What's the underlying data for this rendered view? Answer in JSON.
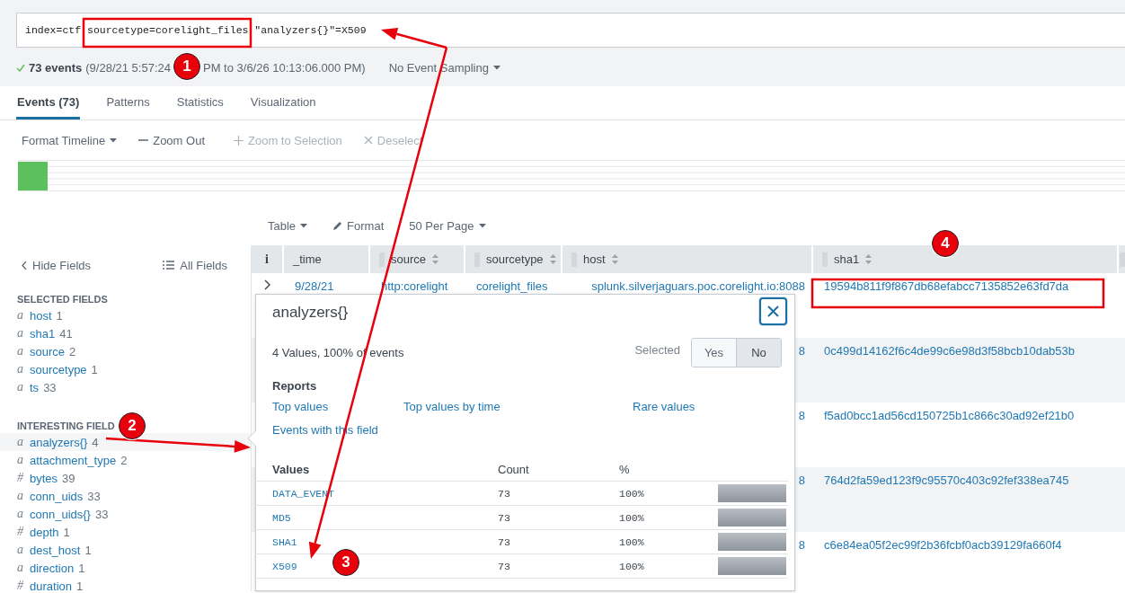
{
  "search": {
    "query": "index=ctf sourcetype=corelight_files \"analyzers{}\"=X509"
  },
  "status": {
    "count": "73 events",
    "range_start": "(9/28/21 5:57:24",
    "range_end": "PM to 3/6/26 10:13:06.000 PM)",
    "sampling": "No Event Sampling"
  },
  "tabs": [
    {
      "label": "Events (73)",
      "selected": true
    },
    {
      "label": "Patterns",
      "selected": false
    },
    {
      "label": "Statistics",
      "selected": false
    },
    {
      "label": "Visualization",
      "selected": false
    }
  ],
  "timeline_toolbar": [
    {
      "kind": "menu",
      "label": "Format Timeline",
      "disabled": false
    },
    {
      "kind": "minus",
      "label": "Zoom Out",
      "disabled": false
    },
    {
      "kind": "plus",
      "label": "Zoom to Selection",
      "disabled": true
    },
    {
      "kind": "cross",
      "label": "Deselect",
      "disabled": true
    }
  ],
  "results_toolbar": [
    {
      "kind": "menu",
      "label": "Table"
    },
    {
      "kind": "pencil",
      "label": "Format"
    },
    {
      "kind": "menu",
      "label": "50 Per Page"
    }
  ],
  "sidebar": {
    "hide_label": "Hide Fields",
    "all_label": "All Fields",
    "sections": [
      {
        "title": "SELECTED FIELDS",
        "fields": [
          {
            "type": "a",
            "name": "host",
            "count": "1",
            "selected": false
          },
          {
            "type": "a",
            "name": "sha1",
            "count": "41",
            "selected": false
          },
          {
            "type": "a",
            "name": "source",
            "count": "2",
            "selected": false
          },
          {
            "type": "a",
            "name": "sourcetype",
            "count": "1",
            "selected": false
          },
          {
            "type": "a",
            "name": "ts",
            "count": "33",
            "selected": false
          }
        ]
      },
      {
        "title": "INTERESTING FIELD",
        "fields": [
          {
            "type": "a",
            "name": "analyzers{}",
            "count": "4",
            "selected": true
          },
          {
            "type": "a",
            "name": "attachment_type",
            "count": "2",
            "selected": false
          },
          {
            "type": "#",
            "name": "bytes",
            "count": "39",
            "selected": false
          },
          {
            "type": "a",
            "name": "conn_uids",
            "count": "33",
            "selected": false
          },
          {
            "type": "a",
            "name": "conn_uids{}",
            "count": "33",
            "selected": false
          },
          {
            "type": "#",
            "name": "depth",
            "count": "1",
            "selected": false
          },
          {
            "type": "a",
            "name": "dest_host",
            "count": "1",
            "selected": false
          },
          {
            "type": "a",
            "name": "direction",
            "count": "1",
            "selected": false
          },
          {
            "type": "#",
            "name": "duration",
            "count": "1",
            "selected": false
          }
        ]
      }
    ]
  },
  "table": {
    "columns": [
      {
        "label": "i",
        "sortable": false,
        "draggable": false
      },
      {
        "label": "_time",
        "sortable": false,
        "draggable": false
      },
      {
        "label": "source",
        "sortable": true,
        "draggable": true
      },
      {
        "label": "sourcetype",
        "sortable": true,
        "draggable": true
      },
      {
        "label": "host",
        "sortable": true,
        "draggable": true
      },
      {
        "label": "sha1",
        "sortable": true,
        "draggable": true
      }
    ],
    "rows": [
      {
        "expandable": true,
        "time": "9/28/21",
        "source": "http:corelight",
        "sourcetype": "corelight_files",
        "host": "splunk.silverjaguars.poc.corelight.io:8088",
        "sha1": "19594b811f9f867db68efabcc7135852e63fd7da"
      },
      {
        "host": "8",
        "sha1": "0c499d14162f6c4de99c6e98d3f58bcb10dab53b"
      },
      {
        "host": "8",
        "sha1": "f5ad0bcc1ad56cd150725b1c866c30ad92ef21b0"
      },
      {
        "host": "8",
        "sha1": "764d2fa59ed123f9c95570c403c92fef338ea745"
      },
      {
        "host": "8",
        "sha1": "c6e84ea05f2ec99f2b36fcbf0acb39129fa660f4"
      }
    ]
  },
  "field_popup": {
    "title": "analyzers{}",
    "summary": "4 Values, 100% of events",
    "selected_label": "Selected",
    "selected_options": [
      {
        "label": "Yes",
        "selected": false
      },
      {
        "label": "No",
        "selected": true
      }
    ],
    "reports_title": "Reports",
    "reports": [
      "Top values",
      "Top values by time",
      "Rare values",
      "Events with this field"
    ],
    "values_columns": [
      "Values",
      "Count",
      "%"
    ],
    "values": [
      {
        "value": "DATA_EVENT",
        "count": "73",
        "percent": "100%",
        "level": 1
      },
      {
        "value": "MD5",
        "count": "73",
        "percent": "100%",
        "level": 1
      },
      {
        "value": "SHA1",
        "count": "73",
        "percent": "100%",
        "level": 1
      },
      {
        "value": "X509",
        "count": "73",
        "percent": "100%",
        "level": 1
      }
    ]
  },
  "annotations": {
    "badges": [
      {
        "label": "1"
      },
      {
        "label": "2"
      },
      {
        "label": "3"
      },
      {
        "label": "4"
      }
    ]
  }
}
